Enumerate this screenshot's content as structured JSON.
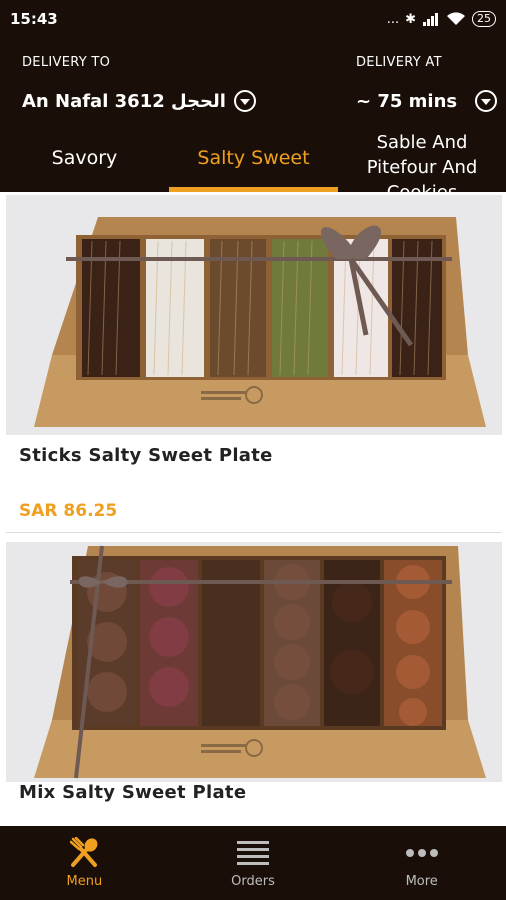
{
  "status_bar": {
    "time": "15:43",
    "signal_dots": "...",
    "battery": "25"
  },
  "header": {
    "delivery_to_label": "DELIVERY TO",
    "delivery_to_value": "An Nafal الحجل 3612",
    "delivery_at_label": "DELIVERY AT",
    "delivery_at_value": "~ 75 mins"
  },
  "tabs": [
    {
      "label": "Savory",
      "active": false
    },
    {
      "label": "Salty Sweet",
      "active": true
    },
    {
      "label_lines": [
        "Sable And",
        "Pitefour  And",
        "Cookies"
      ],
      "active": false
    }
  ],
  "products": [
    {
      "title": "Sticks Salty Sweet Plate",
      "price": "SAR 86.25"
    },
    {
      "title": "Mix Salty Sweet Plate"
    }
  ],
  "bottom_nav": [
    {
      "label": "Menu",
      "icon": "fork-spoon-icon",
      "active": true
    },
    {
      "label": "Orders",
      "icon": "list-icon",
      "active": false
    },
    {
      "label": "More",
      "icon": "more-dots-icon",
      "active": false
    }
  ],
  "colors": {
    "header_bg": "#1a0f08",
    "accent": "#f0a020",
    "tray": "#b98a55"
  }
}
